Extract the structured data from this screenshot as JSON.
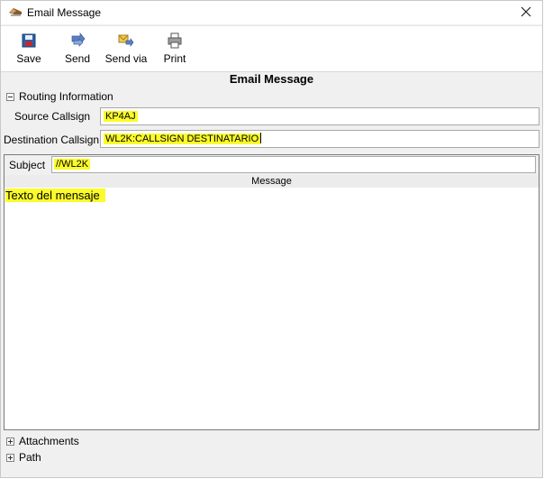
{
  "window": {
    "title": "Email Message"
  },
  "toolbar": {
    "buttons": [
      {
        "label": "Save",
        "icon": "save-icon"
      },
      {
        "label": "Send",
        "icon": "send-icon"
      },
      {
        "label": "Send via",
        "icon": "send-via-icon"
      },
      {
        "label": "Print",
        "icon": "print-icon"
      }
    ]
  },
  "form": {
    "title": "Email Message",
    "routing": {
      "label": "Routing Information",
      "source_label": "Source Callsign",
      "source_value": "KP4AJ",
      "destination_label": "Destination Callsign",
      "destination_value": "WL2K:CALLSIGN DESTINATARIO"
    },
    "subject_label": "Subject",
    "subject_value": "//WL2K",
    "message_header": "Message",
    "message_text": "Texto del mensaje",
    "attachments_label": "Attachments",
    "path_label": "Path"
  },
  "colors": {
    "highlight": "#fbfb2b",
    "window_bg": "#f0f0f0"
  }
}
